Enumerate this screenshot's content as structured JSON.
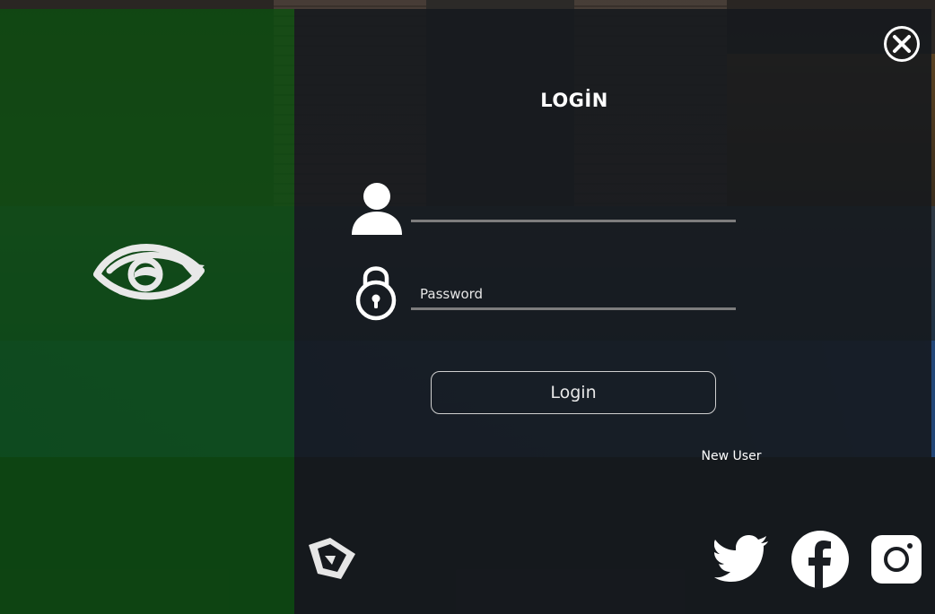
{
  "dialog": {
    "title": "LOGİN"
  },
  "form": {
    "username": {
      "value": "",
      "placeholder": ""
    },
    "password": {
      "value": "",
      "placeholder": "Password"
    },
    "login_label": "Login",
    "new_user_label": "New User"
  },
  "icons": {
    "close": "close-icon",
    "user": "user-icon",
    "lock": "lock-icon",
    "logo": "eye-logo-icon",
    "badge": "brand-badge-icon",
    "twitter": "twitter-icon",
    "facebook": "facebook-icon",
    "instagram": "instagram-icon"
  },
  "colors": {
    "left_panel": "#0c4e10",
    "main_panel": "#16191e",
    "text": "#ffffff",
    "field_underline": "#7d7d7d"
  }
}
